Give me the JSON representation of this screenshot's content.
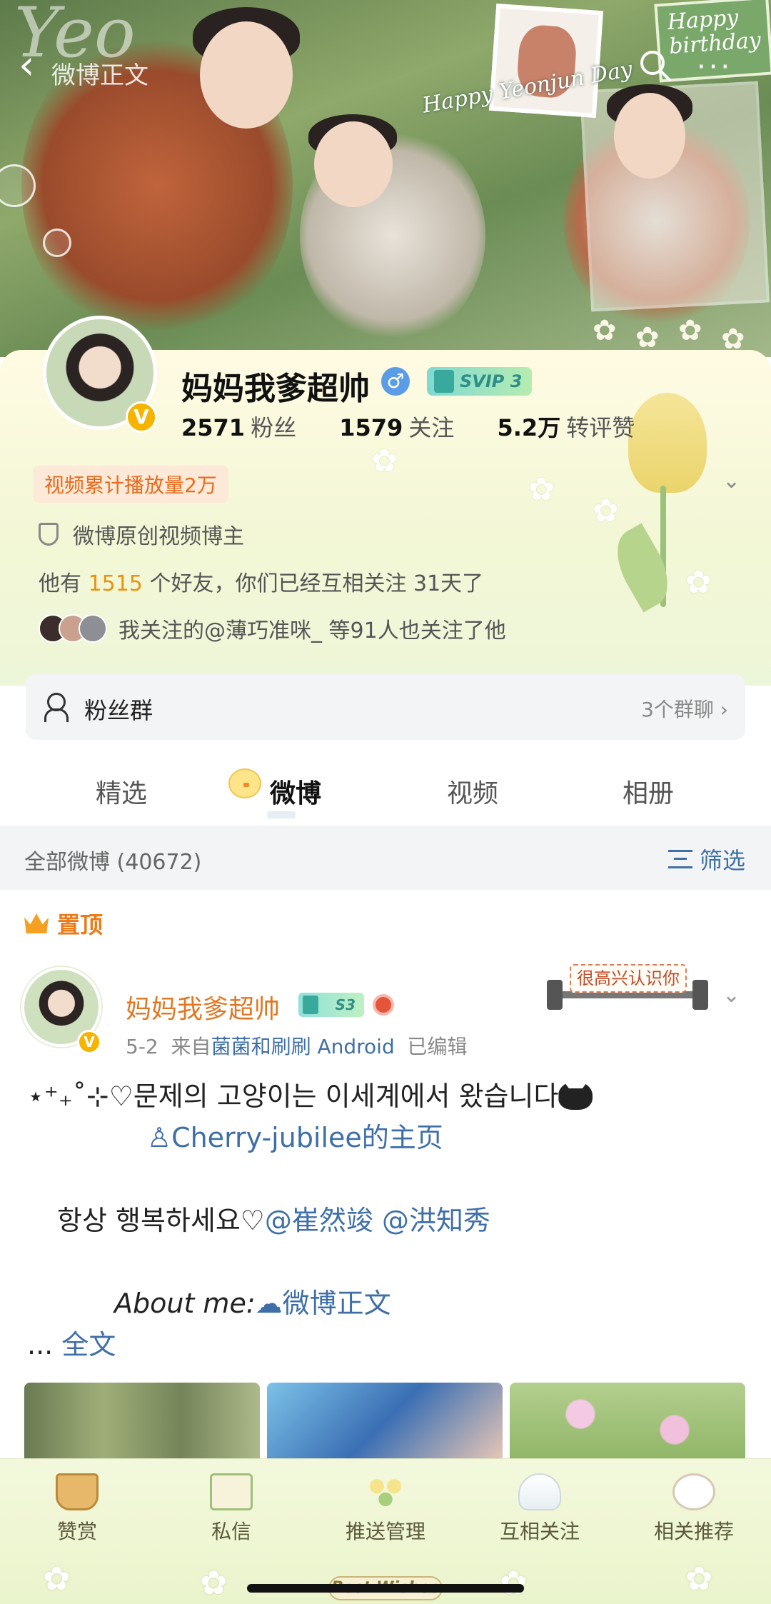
{
  "banner": {
    "watermark_text": "Yeo",
    "happy_text": "Happy Yeonjun Day",
    "birthday_text": "Happy birthday"
  },
  "nav": {
    "back_icon": "chevron-left-icon",
    "title": "微博正文",
    "search_icon": "search-icon",
    "more_icon": "more-dots-icon",
    "more_glyph": "···"
  },
  "profile": {
    "username": "妈妈我爹超帅",
    "gender_icon": "male-icon",
    "gender_glyph": "♂",
    "svip_label": "SVIP 3",
    "verified_glyph": "V",
    "stats": {
      "fans_value": "2571",
      "fans_label": "粉丝",
      "following_value": "1579",
      "following_label": "关注",
      "engagement_value": "5.2万",
      "engagement_label": "转评赞"
    },
    "play_tag": "视频累计播放量2万",
    "verify_text": "微博原创视频博主",
    "friends_prefix": "他有",
    "friends_count": "1515",
    "friends_suffix": "个好友，你们已经互相关注 31天了",
    "mutual_text": "我关注的@薄巧准咪_ 等91人也关注了他"
  },
  "fan_group": {
    "label": "粉丝群",
    "right_text": "3个群聊",
    "chevron": "›"
  },
  "tabs": [
    {
      "label": "精选",
      "active": false
    },
    {
      "label": "微博",
      "active": true
    },
    {
      "label": "视频",
      "active": false
    },
    {
      "label": "相册",
      "active": false
    }
  ],
  "filter_bar": {
    "count_text": "全部微博 (40672)",
    "filter_label": "筛选"
  },
  "pinned_label": "置顶",
  "post": {
    "author": "妈妈我爹超帅",
    "level_badge": "S3",
    "date": "5-2",
    "source_prefix": "来自",
    "source": "菌菌和刷刷 Android",
    "edited": "已编辑",
    "sticker_text": "很高兴认识你",
    "chevron": "⌄",
    "line1": "⋆⁺₊˚⊹♡문제의 고양이는 이세계에서 왔습니다",
    "line2": "♙Cherry-jubilee的主页",
    "line3_text": "항상 행복하세요♡",
    "line3_mentions": "@崔然竣 @洪知秀",
    "line4_about": "About me:",
    "line4_link": "☁微博正文",
    "more_prefix": "... ",
    "more_link": "全文"
  },
  "bottom_bar": {
    "items": [
      {
        "label": "赞赏",
        "icon": "gift-basket-icon"
      },
      {
        "label": "私信",
        "icon": "message-envelope-icon"
      },
      {
        "label": "推送管理",
        "icon": "flower-bouquet-icon"
      },
      {
        "label": "互相关注",
        "icon": "cloud-rainbow-icon"
      },
      {
        "label": "相关推荐",
        "icon": "sheep-icon"
      }
    ],
    "best_wishes": "Best Wishes"
  }
}
